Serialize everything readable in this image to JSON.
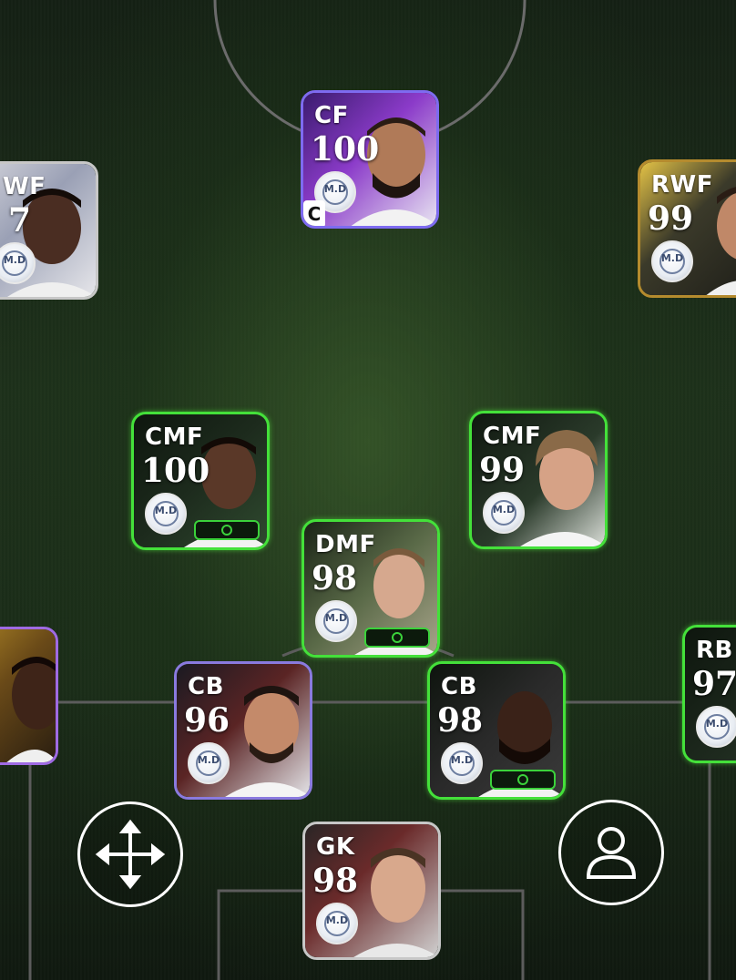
{
  "lineup": {
    "cf": {
      "position": "CF",
      "rating": "100",
      "captain": "C",
      "badge": "M.D"
    },
    "lwf": {
      "position": "WF",
      "rating": "7",
      "badge": "M.D"
    },
    "rwf": {
      "position": "RWF",
      "rating": "99",
      "badge": "M.D"
    },
    "lcmf": {
      "position": "CMF",
      "rating": "100",
      "badge": "M.D"
    },
    "rcmf": {
      "position": "CMF",
      "rating": "99",
      "badge": "M.D"
    },
    "dmf": {
      "position": "DMF",
      "rating": "98",
      "badge": "M.D"
    },
    "lcb": {
      "position": "CB",
      "rating": "96",
      "badge": "M.D"
    },
    "rcb": {
      "position": "CB",
      "rating": "98",
      "badge": "M.D"
    },
    "rb": {
      "position": "RB",
      "rating": "97",
      "badge": "M.D"
    },
    "gk": {
      "position": "GK",
      "rating": "98",
      "badge": "M.D"
    }
  },
  "controls": {
    "move_icon": "move-arrows-icon",
    "player_icon": "person-icon"
  },
  "colors": {
    "green_frame": "#44e03a",
    "purple_frame": "#9f6ae3",
    "gold_frame": "#b58b2e",
    "grey_frame": "#c7c7c7",
    "pitch": "#1d301a"
  }
}
